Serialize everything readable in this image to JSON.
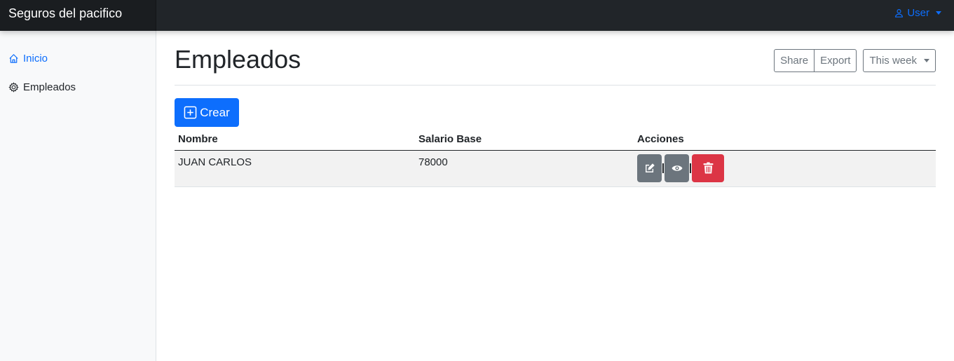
{
  "navbar": {
    "brand": "Seguros del pacifico",
    "user_label": "User"
  },
  "sidebar": {
    "items": [
      {
        "label": "Inicio",
        "icon": "home-icon",
        "active": true
      },
      {
        "label": "Empleados",
        "icon": "gear-icon",
        "active": false
      }
    ]
  },
  "main": {
    "title": "Empleados",
    "toolbar": {
      "share_label": "Share",
      "export_label": "Export",
      "period_label": "This week"
    },
    "create_label": "Crear",
    "table": {
      "headers": [
        "Nombre",
        "Salario Base",
        "Acciones"
      ],
      "rows": [
        {
          "nombre": "JUAN CARLOS",
          "salario": "78000"
        }
      ]
    }
  },
  "colors": {
    "navbar": "#212529",
    "primary": "#0d6efd",
    "secondary": "#6c757d",
    "danger": "#dc3545"
  }
}
